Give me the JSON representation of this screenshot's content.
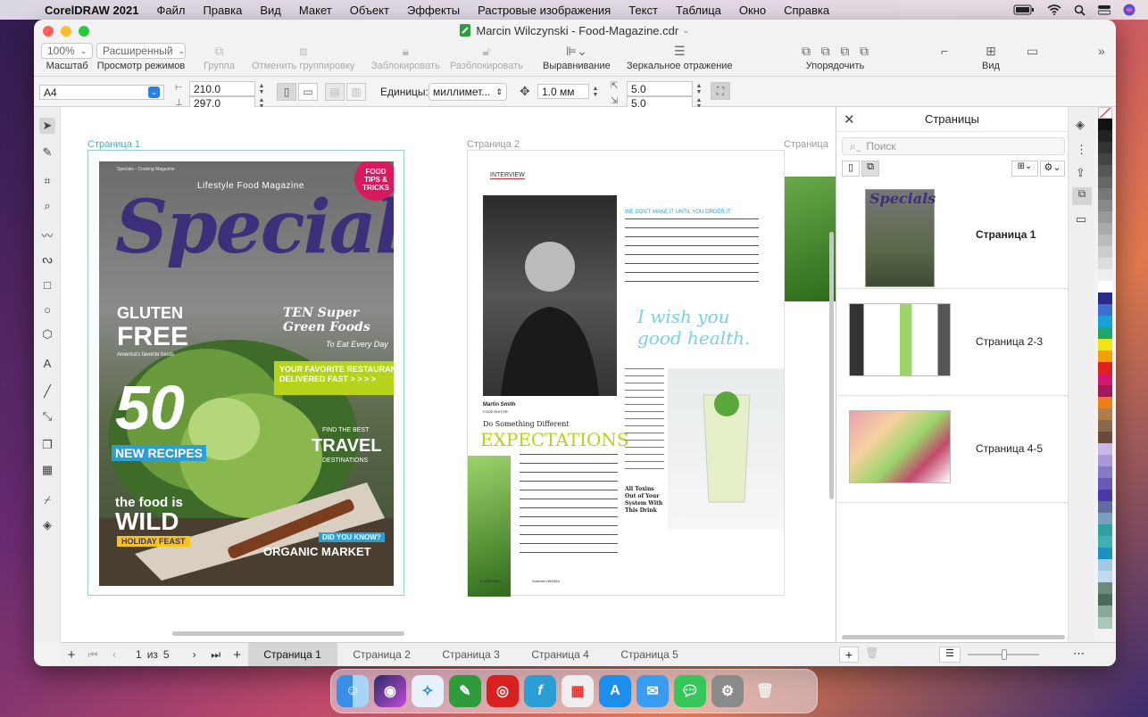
{
  "menubar": {
    "app": "CorelDRAW 2021",
    "items": [
      "Файл",
      "Правка",
      "Вид",
      "Макет",
      "Объект",
      "Эффекты",
      "Растровые изображения",
      "Текст",
      "Таблица",
      "Окно",
      "Справка"
    ]
  },
  "window": {
    "title": "Marcin Wilczynski - Food-Magazine.cdr"
  },
  "toolbar": {
    "zoom": "100%",
    "zoom_label": "Масштаб",
    "view_mode": "Расширенный",
    "view_mode_label": "Просмотр режимов",
    "group": "Группа",
    "ungroup": "Отменить группировку",
    "lock": "Заблокировать",
    "unlock": "Разблокировать",
    "align": "Выравнивание",
    "mirror": "Зеркальное отражение",
    "arrange": "Упорядочить",
    "view": "Вид"
  },
  "propbar": {
    "page_size": "A4",
    "width": "210.0",
    "height": "297.0",
    "units_label": "Единицы:",
    "units": "миллимет...",
    "nudge": "1.0 мм",
    "dup_x": "5.0",
    "dup_y": "5.0"
  },
  "canvas": {
    "page1_label": "Страница 1",
    "page2_label": "Страница 2",
    "page3_label": "Страница"
  },
  "cover": {
    "small_top": "Specials - Cooking Magazine",
    "subtitle": "Lifestyle Food Magazine",
    "title": "Specials",
    "badge": "FOOD TIPS & TRICKS",
    "gluten1": "GLUTEN",
    "gluten2": "FREE",
    "gluten_sub": "America's favorite foods",
    "fifty": "50",
    "recipes": "NEW RECIPES",
    "ten": "TEN Super Green Foods",
    "ten_sub": "To Eat Every Day",
    "restaurants": "YOUR FAVORITE RESTAURANTS, DELIVERED FAST > > > >",
    "travel_small": "FIND THE BEST",
    "travel": "TRAVEL",
    "travel_sub": "DESTINATIONS",
    "wild1": "the food is",
    "wild2": "WILD",
    "feast": "HOLIDAY FEAST",
    "didyou": "DID YOU KNOW?",
    "organic": "ORGANIC MARKET"
  },
  "spread": {
    "interview": "INTERVIEW",
    "quote_head": "WE DON'T MAKE IT UNTIL YOU ORDER IT",
    "wish": "I wish you good health.",
    "name": "Martin Smith",
    "role": "FOOD EDITOR",
    "do_something": "Do Something Different",
    "expectations": "EXPECTATIONS",
    "toxins": "All Toxins Out of Your System With This Drink",
    "footer_left": "2 SPECIALS",
    "footer_mid": "Summer 06/2064"
  },
  "pages_panel": {
    "title": "Страницы",
    "search_placeholder": "Поиск",
    "rows": [
      "Страница 1",
      "Страница 2-3",
      "Страница 4-5"
    ]
  },
  "bottom": {
    "counter": "1",
    "of": "из",
    "total": "5",
    "tabs": [
      "Страница 1",
      "Страница 2",
      "Страница 3",
      "Страница 4",
      "Страница 5"
    ]
  },
  "palette": [
    "#ffffff",
    "#111111",
    "#222222",
    "#333333",
    "#444444",
    "#555555",
    "#666666",
    "#777777",
    "#888888",
    "#999999",
    "#aaaaaa",
    "#bbbbbb",
    "#cccccc",
    "#dddddd",
    "#eeeeee",
    "#ffffff",
    "#2a2a8a",
    "#3a6fd1",
    "#18a0d8",
    "#1ca86b",
    "#f2e414",
    "#f5a000",
    "#e3211c",
    "#d4166f",
    "#a3185b",
    "#f07c1a",
    "#b07d4a",
    "#8a6a4a",
    "#6a4a3a",
    "#c8b8e8",
    "#a898d8",
    "#8878c8",
    "#6858b8",
    "#4838a8",
    "#5e6e9e",
    "#7e9ebe",
    "#2ea0a0",
    "#3eb0b0",
    "#1e90c0",
    "#a0c8e0",
    "#c0d8f0",
    "#6a8a7a",
    "#4a6a5a",
    "#8aa89a",
    "#aac8ba"
  ],
  "colors": {
    "accent": "#2a9fd6",
    "lime": "#b5d31a",
    "purple": "#3d2f7a"
  }
}
